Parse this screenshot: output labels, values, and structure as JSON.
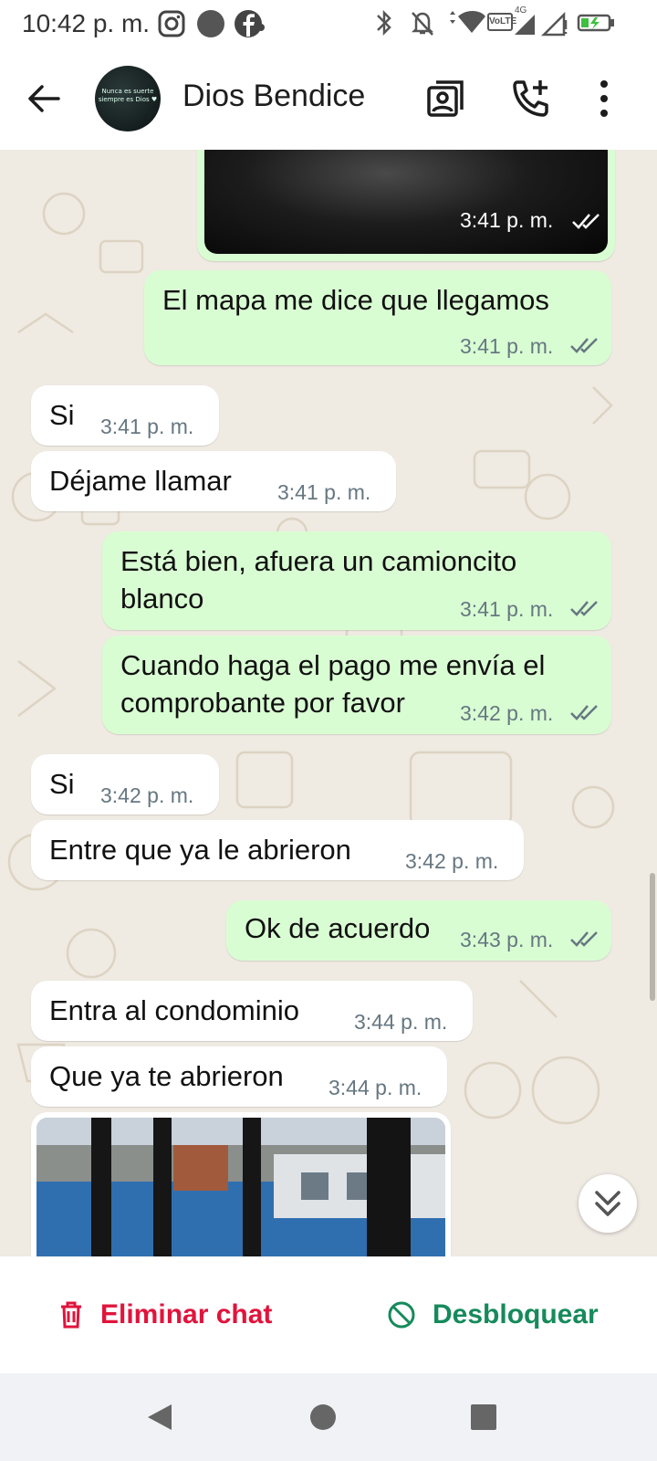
{
  "status_bar": {
    "time": "10:42 p. m.",
    "icons": [
      "instagram-icon",
      "circle-icon",
      "facebook-icon",
      "bluetooth-icon",
      "mute-icon",
      "wifi-icon",
      "volte-icon",
      "signal-icon",
      "battery-icon"
    ],
    "network_label": "VoLTE",
    "data_label": "4G"
  },
  "header": {
    "contact_name": "Dios Bendice",
    "avatar_text": "Nunca es suerte siempre es Dios ♥",
    "icons": [
      "back-arrow-icon",
      "contact-card-icon",
      "add-call-icon",
      "more-vert-icon"
    ]
  },
  "messages": [
    {
      "dir": "out",
      "type": "image",
      "time": "3:41 p. m.",
      "status": "read"
    },
    {
      "dir": "out",
      "text": "El mapa me dice que llegamos",
      "time": "3:41 p. m.",
      "status": "read"
    },
    {
      "dir": "in",
      "text": "Si",
      "time": "3:41 p. m."
    },
    {
      "dir": "in",
      "text": "Déjame llamar",
      "time": "3:41 p. m."
    },
    {
      "dir": "out",
      "text": "Está bien, afuera un camioncito blanco",
      "time": "3:41 p. m.",
      "status": "read"
    },
    {
      "dir": "out",
      "text": "Cuando haga el pago me envía el comprobante por favor",
      "time": "3:42 p. m.",
      "status": "read"
    },
    {
      "dir": "in",
      "text": "Si",
      "time": "3:42 p. m."
    },
    {
      "dir": "in",
      "text": "Entre que ya le abrieron",
      "time": "3:42 p. m."
    },
    {
      "dir": "out",
      "text": "Ok de acuerdo",
      "time": "3:43 p. m.",
      "status": "read"
    },
    {
      "dir": "in",
      "text": "Entra al condominio",
      "time": "3:44 p. m."
    },
    {
      "dir": "in",
      "text": "Que ya te abrieron",
      "time": "3:44 p. m."
    },
    {
      "dir": "in",
      "type": "image"
    }
  ],
  "actions": {
    "delete_label": "Eliminar chat",
    "unblock_label": "Desbloquear"
  },
  "colors": {
    "outgoing_bubble": "#d9fdd3",
    "incoming_bubble": "#ffffff",
    "chat_background": "#efeae2",
    "delete_red": "#e0143c",
    "unblock_green": "#168a5b",
    "read_ticks": "#667781"
  }
}
